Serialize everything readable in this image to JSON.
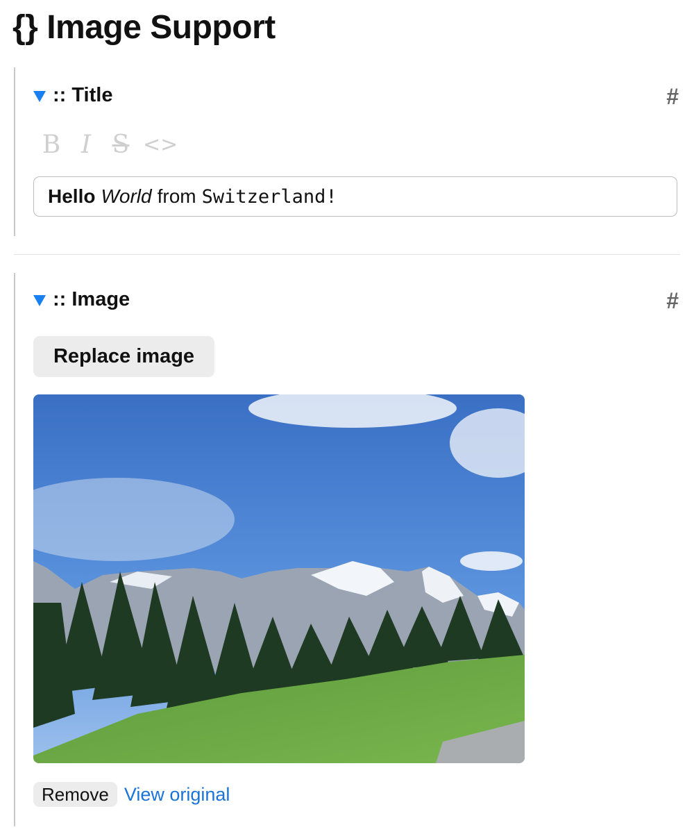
{
  "page": {
    "title_icon": "{}",
    "title": "Image Support"
  },
  "sections": [
    {
      "marker": ":: Title",
      "anchor_symbol": "#",
      "toolbar": [
        {
          "name": "bold",
          "glyph": "B"
        },
        {
          "name": "italic",
          "glyph": "I"
        },
        {
          "name": "strikethrough",
          "glyph": "S"
        },
        {
          "name": "code",
          "glyph": "<>"
        }
      ],
      "value": {
        "bold": "Hello",
        "italic": "World",
        "plain": "from",
        "code": "Switzerland!"
      }
    },
    {
      "marker": ":: Image",
      "anchor_symbol": "#",
      "replace_label": "Replace image",
      "image_alt": "Swiss Alps with snowy peaks, pine trees and green meadow",
      "remove_label": "Remove",
      "view_original_label": "View original"
    }
  ],
  "colors": {
    "accent": "#1a7ff0",
    "link": "#1a74d8",
    "button_bg": "#ececec"
  }
}
